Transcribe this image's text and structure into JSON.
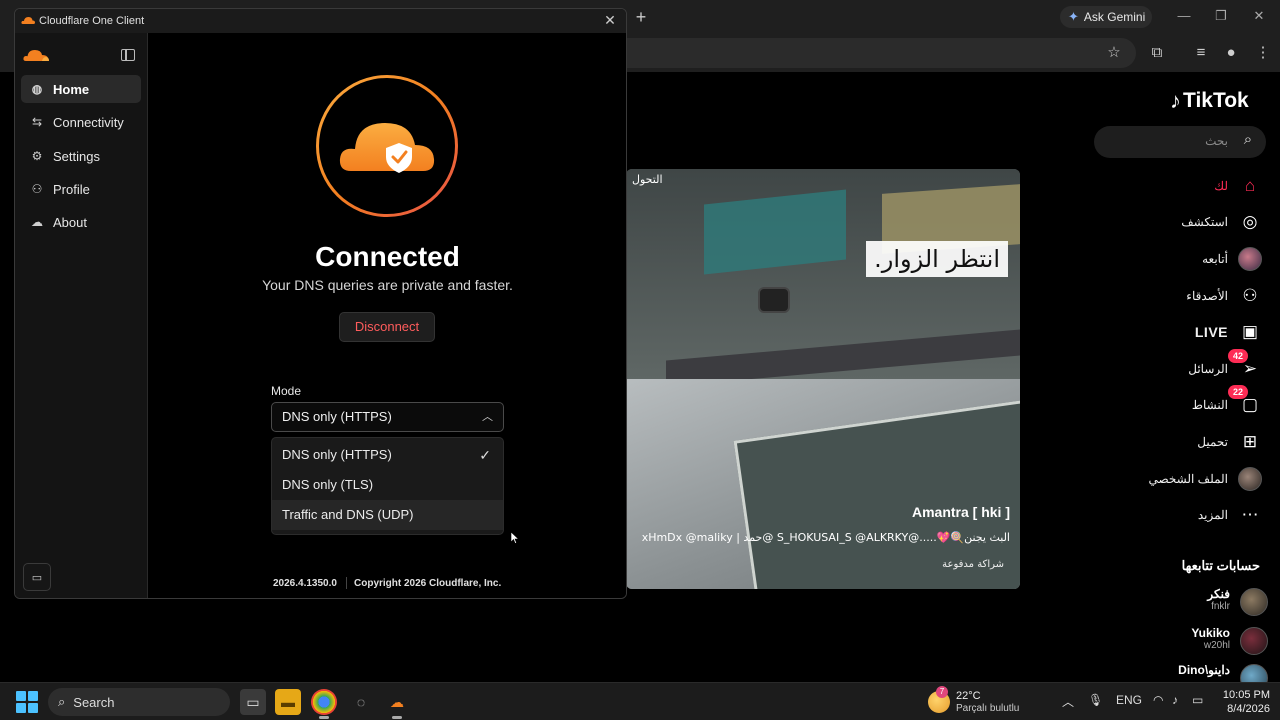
{
  "browser": {
    "new_tab": "+",
    "ask_gemini": "Ask Gemini",
    "minimize": "—",
    "maximize": "❐",
    "close": "✕"
  },
  "tiktok": {
    "logo_text": "TikTok",
    "search_placeholder": "بحث",
    "nav": [
      {
        "label": "لك",
        "icon": "home-icon"
      },
      {
        "label": "استكشف",
        "icon": "compass-icon"
      },
      {
        "label": "أتابعه",
        "icon": "avatar-icon"
      },
      {
        "label": "الأصدقاء",
        "icon": "friends-icon"
      },
      {
        "label": "LIVE",
        "icon": "live-icon"
      },
      {
        "label": "الرسائل",
        "icon": "messages-icon",
        "badge": "42"
      },
      {
        "label": "النشاط",
        "icon": "activity-icon",
        "badge": "22"
      },
      {
        "label": "تحميل",
        "icon": "upload-icon"
      },
      {
        "label": "الملف الشخصي",
        "icon": "profile-avatar-icon"
      },
      {
        "label": "المزيد",
        "icon": "more-icon"
      }
    ],
    "following_heading": "حسابات تتابعها",
    "following": [
      {
        "name": "فنكر",
        "username": "fnklr"
      },
      {
        "name": "Yukiko",
        "username": "w20hl"
      },
      {
        "name": "Dino\\داينو",
        "username": ""
      }
    ],
    "video": {
      "corner_text": "التحول",
      "caption": "انتظر الزوار.",
      "author": "Amantra [ hki ]",
      "description": "البث يجنن🍭💖.....@S_HOKUSAI_S @ALKRKY @حمد | xHmDx @maliky",
      "paid_label": "شراكة مدفوعة"
    }
  },
  "cloudflare": {
    "window_title": "Cloudflare One Client",
    "close": "✕",
    "nav": [
      {
        "label": "Home",
        "icon": "globe-icon",
        "glyph": "◍"
      },
      {
        "label": "Connectivity",
        "icon": "connectivity-icon",
        "glyph": "⇆"
      },
      {
        "label": "Settings",
        "icon": "gear-icon",
        "glyph": "⚙"
      },
      {
        "label": "Profile",
        "icon": "person-icon",
        "glyph": "⚇"
      },
      {
        "label": "About",
        "icon": "cloud-icon",
        "glyph": "☁"
      }
    ],
    "status_title": "Connected",
    "status_subtitle": "Your DNS queries are private and faster.",
    "disconnect_label": "Disconnect",
    "mode_label": "Mode",
    "mode_selected": "DNS only (HTTPS)",
    "mode_options": [
      "DNS only (HTTPS)",
      "DNS only (TLS)",
      "Traffic and DNS (UDP)"
    ],
    "version": "2026.4.1350.0",
    "copyright": "Copyright 2026 Cloudflare, Inc.",
    "accent": "#f38020",
    "accent_light": "#fbad41",
    "danger": "#ff5c5c"
  },
  "taskbar": {
    "search_label": "Search",
    "weather_temp": "22°C",
    "weather_condition": "Parçalı bulutlu",
    "weather_badge": "7",
    "language": "ENG",
    "time": "10:05 PM",
    "date": "8/4/2026"
  }
}
